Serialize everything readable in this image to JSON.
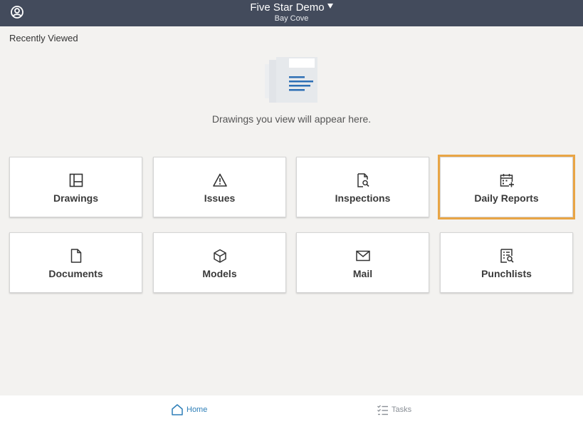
{
  "header": {
    "project_name": "Five Star Demo",
    "location": "Bay Cove",
    "account_icon": "account-circle-icon",
    "dropdown_icon": "caret-down-icon"
  },
  "recent": {
    "title": "Recently Viewed",
    "empty_message": "Drawings you view will appear here.",
    "illustration": "drawing-document-icon"
  },
  "tools": [
    {
      "label": "Drawings",
      "icon": "drawings-icon"
    },
    {
      "label": "Issues",
      "icon": "warning-triangle-icon"
    },
    {
      "label": "Inspections",
      "icon": "document-search-icon"
    },
    {
      "label": "Daily Reports",
      "icon": "calendar-add-icon",
      "selected": true
    },
    {
      "label": "Documents",
      "icon": "document-icon"
    },
    {
      "label": "Models",
      "icon": "cube-icon"
    },
    {
      "label": "Mail",
      "icon": "mail-icon"
    },
    {
      "label": "Punchlists",
      "icon": "punchlist-icon"
    }
  ],
  "tabs": [
    {
      "label": "Home",
      "icon": "home-icon",
      "active": true
    },
    {
      "label": "Tasks",
      "icon": "tasks-checklist-icon",
      "active": false
    }
  ],
  "colors": {
    "header_bg": "#434b5c",
    "selected_outline": "#e9a545",
    "active_tab": "#2e7fb8",
    "inactive_tab": "#8a8f96"
  }
}
